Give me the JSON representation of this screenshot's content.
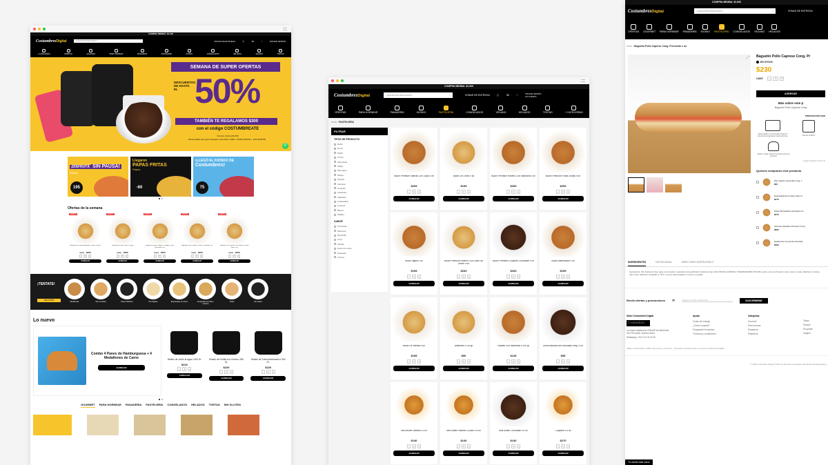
{
  "brand": {
    "logo": "Costumbres",
    "logo_sub": "Digital"
  },
  "colors": {
    "accent": "#f7c52b",
    "black": "#000000",
    "purple": "#5a2a8c"
  },
  "common": {
    "min_purchase": "COMPRA MÍNIMA: $1.000",
    "search_placeholder": "¿QUÉ ESTÁS BUSCANDO?",
    "delivery_zones": "ZONAS DE ENTREGA",
    "cart_total": "$0",
    "login": "INICIAR SESIÓN",
    "account": "MI CUENTA",
    "add": "AGREGAR",
    "qty": "1",
    "minus": "–",
    "plus": "+"
  },
  "w1": {
    "min_purchase": "COMPRA MÍNIMA: $1.000",
    "nav": [
      "+ CATEGORÍAS",
      "OFERTAS",
      "GOURMET",
      "PARA HORNEAR",
      "PANADERÍA",
      "PASTELERÍA",
      "KIOSKO",
      "CONGELADOS",
      "HELADOS",
      "VEGANO",
      "TORTAS"
    ],
    "hero": {
      "banner": "SEMANA DE SUPER OFERTAS",
      "prefix": "DESCUENTOS DE HASTA EL",
      "percent": "50%",
      "gift": "TAMBIÉN TE REGALAMOS $300",
      "code": "con el código COSTUMBREATE",
      "fine1": "Compra mínima $1.000",
      "fine2": "Oferta válida solo para entregas a domicilio. CABA + ZONA NORTE + SAN MARTÍN"
    },
    "promos": [
      {
        "line1": "¡DISFRUTÁ",
        "line2": "SIN PAUSA!",
        "tag": "Pizzas",
        "price": "195"
      },
      {
        "line1": "Llegaron",
        "line2": "PAPAS FRITAS",
        "tag": "Papas",
        "price": "-60"
      },
      {
        "line1": "¡LLEGÓ EL KIOSKO DE",
        "line2": "Costumbres!",
        "tag": "",
        "price": "75"
      }
    ],
    "offers_title": "Ofertas de la semana",
    "offers": [
      {
        "badge": "OFERTA",
        "name": "Buñuelos de Papa Rebozados Cong. x 400 gr",
        "old": "$350",
        "price": "$299"
      },
      {
        "badge": "OFERTA",
        "name": "Formitas de Pollo Cong. x 500gr",
        "old": "$380",
        "price": "$299"
      },
      {
        "badge": "OFERTA",
        "name": "Baguetín Ternera Jamón y Cheddar Cong. Precocido x un",
        "old": "$238",
        "price": "$209"
      },
      {
        "badge": "OFERTA",
        "name": "Baguetín Pollo Caprese Cong. Precocido x un",
        "old": "$238",
        "price": "$209"
      },
      {
        "badge": "OFERTA",
        "name": "Sándwich Pan Lomito Con Jamón y Queso Cong. x un",
        "old": "$238",
        "price": "$209"
      }
    ],
    "try_title": "¡TENTATE!",
    "try_button": "VER TODOS",
    "try_items": [
      "Medialunas",
      "Pan de Masa",
      "Panes Rústicos",
      "Pan Migñon",
      "Empanadas de Carne",
      "Empanada de Pollo y Verdura",
      "Chipá",
      "Sin Gluten"
    ],
    "new_title": "Lo nuevo",
    "combo": {
      "name": "Combo 4 Panes de Hamburguesa + 4 Medallones de Carne",
      "button": "AGREGAR"
    },
    "icecreams": [
      {
        "name": "Helado de Limón al agua x 300 Gr.",
        "price": "$220"
      },
      {
        "name": "Helado de Frutilla a la Crema x 300 Gr.",
        "price": "$220"
      },
      {
        "name": "Helado de Crema Americana x 300 Gr.",
        "price": "$220"
      }
    ],
    "tabs": [
      "GOURMET",
      "PARA HORNEAR",
      "PANADERÍA",
      "PASTELERÍA",
      "CONGELADOS",
      "HELADOS",
      "TORTAS",
      "SIN GLUTEN"
    ]
  },
  "w2": {
    "nav": [
      "OFERTAS",
      "PARA HORNEAR",
      "PANADERÍA",
      "KIOSKO",
      "PASTELERÍA",
      "CONGELADOS",
      "VEGANO",
      "HELADOS",
      "TORTAS",
      "+ CATEGORÍAS"
    ],
    "breadcrumb_home": "Inicio",
    "breadcrumb_current": "PASTELERÍA",
    "filter_title": "FILTRAR",
    "type_title": "TIPOS DE PRODUCTO",
    "types": [
      "Budín",
      "Donut",
      "Muffin",
      "Churro",
      "Palmeritas",
      "Alfajor",
      "Merengue",
      "Masas",
      "Pepitas",
      "Facturas",
      "Coquitas",
      "Tarteletas",
      "Galletitas",
      "Cuadraditos",
      "Amaretti",
      "Biscuit",
      "Waffles"
    ],
    "flavor_title": "SABOR",
    "flavors": [
      "Chocolate",
      "Manzana",
      "Membrillo",
      "Coco",
      "Vainilla",
      "Dulce de Leche",
      "Glaseado",
      "Cítricos"
    ],
    "products": [
      {
        "name": "Budín Premium Vainilla Con Chips x un",
        "price": "$253",
        "bg": "bg-pastry"
      },
      {
        "name": "Budín De Limón x un",
        "price": "$195",
        "bg": "bg-light"
      },
      {
        "name": "Budín Premium Relleno Con Manzana x un",
        "price": "$253",
        "bg": "bg-pastry"
      },
      {
        "name": "Budín Premium Frutas Secas x un",
        "price": "$253",
        "bg": "bg-pastry"
      },
      {
        "name": "Budín Inglés x un",
        "price": "$195",
        "bg": "bg-pastry"
      },
      {
        "name": "Budín Premium Relleno Con Dulce De Leche x un",
        "price": "$253",
        "bg": "bg-light"
      },
      {
        "name": "Budín Premium Crujiente Chocolate x un",
        "price": "$253",
        "bg": "bg-choc"
      },
      {
        "name": "Budín Marmolado x un",
        "price": "$195",
        "bg": "bg-pastry"
      },
      {
        "name": "Budín De Vainilla x un",
        "price": "$195",
        "bg": "bg-light"
      },
      {
        "name": "Amarettis x 100 gr",
        "price": "$90",
        "bg": "bg-light"
      },
      {
        "name": "Pepitas Con Membrillo x 200 gr",
        "price": "$145",
        "bg": "bg-pastry"
      },
      {
        "name": "Donut bañada con chocolate cong. x un",
        "price": "$95",
        "bg": "bg-choc"
      },
      {
        "name": "Mini Muffin Vainilla x 6 un",
        "price": "$140",
        "bg": "bg-cup"
      },
      {
        "name": "Mini Muffin Vainilla C/Dulce x 6 un",
        "price": "$140",
        "bg": "bg-cup"
      },
      {
        "name": "Mini Muffin Chocolate x 6 un",
        "price": "$140",
        "bg": "bg-choc"
      },
      {
        "name": "Coquitos x 6 un",
        "price": "$270",
        "bg": "bg-cup"
      }
    ]
  },
  "w3": {
    "nav": [
      "OFERTAS",
      "GOURMET",
      "PARA HORNEAR",
      "PANADERÍA",
      "KIOSKO",
      "PASTELERÍA",
      "CONGELADOS",
      "VEGANO",
      "HELADOS"
    ],
    "breadcrumb_home": "Inicio",
    "breadcrumb_current": "Baguetín Pollo Caprese Cong. Precocido x un",
    "product_title": "Baguetín Pollo Caprese Cong. Pr",
    "stock": "EN STOCK",
    "price": "$230",
    "qty_label": "CANT.",
    "add_button": "AGREGAR",
    "more_title": "Más sobre este p",
    "more_sub": "Baguetín Pollo Caprese Cong",
    "prep_title": "PREPARACIÓN SEM",
    "prep1": "Descongelar en microondas durante 5 minutos a temperatura máxima (Forma.",
    "prep2": "Hornear a 200°C",
    "prep3": "Retirar y dejar reposar 5 minutos antes de consumir",
    "prep_foot": "Imagen ilustrativa. Forma de",
    "related_title": "Quienes compraron este producto",
    "related": [
      {
        "name": "Pan mignon precocido cong. x",
        "price": "$60"
      },
      {
        "name": "Empanada de humita cruda co",
        "price": "$270"
      },
      {
        "name": "Pizza Muzzarella A la Piedra Co",
        "price": "$370"
      },
      {
        "name": "Torta de Ganache Premium Cong",
        "price": "$809"
      },
      {
        "name": "Helado De Crema De Chocolat",
        "price": "$399"
      }
    ],
    "tabs": [
      "INGREDIENTES",
      "NUTRICIONAL",
      "MIRÁ CÓMO DISFRUTARLO"
    ],
    "ingredients": "Ingredientes: Pan (harina de trigo, agua, sal, levadura, mejorador para panificados (harina de trigo, DHL INSATIA, ENZIMAS Y MEJORADORES INS 300), aceite, polvo de hornear), pollo, queso, tomate, albahaca. Contiene trigo, leche. Mantener congelado a -18°C, una vez descongelado no volver a congelar.",
    "newsletter_label": "Recibí ofertas y promociones",
    "newsletter_placeholder": "Ingresá tu correo electrónico",
    "subscribe": "SUSCRIBIRME",
    "about_title": "Sobre Costumbres Digital",
    "about_text1": "La mayor plataforma ONLINE de Alimentos.",
    "about_text2": "San Fernando, Buenos Aires.",
    "about_text3": "WhatsApp: +54 9 11 00 00 00",
    "help_title": "Ayuda",
    "help": [
      "Zonas de entrega",
      "¿Cómo comprar?",
      "Preguntas Frecuentes",
      "Términos y condiciones"
    ],
    "cat_title": "Categorías",
    "cats1": [
      "Gourmet",
      "Para hornear",
      "Panadería",
      "Pastelería"
    ],
    "cats2": [
      "Tortas",
      "Snacks",
      "Sin gluten",
      "Vegano"
    ],
    "note": "Válido en Zona Norte, CABA, Zona Oeste y Zona Sur - Promoción exclusiva para e-commerce Costumbres Digital",
    "copyright": "© 2020 Costumbres Digital | Todos los derechos reservados | Desarrollo Guoking Agency",
    "cart_empty": "Tu carrito está vacío"
  }
}
